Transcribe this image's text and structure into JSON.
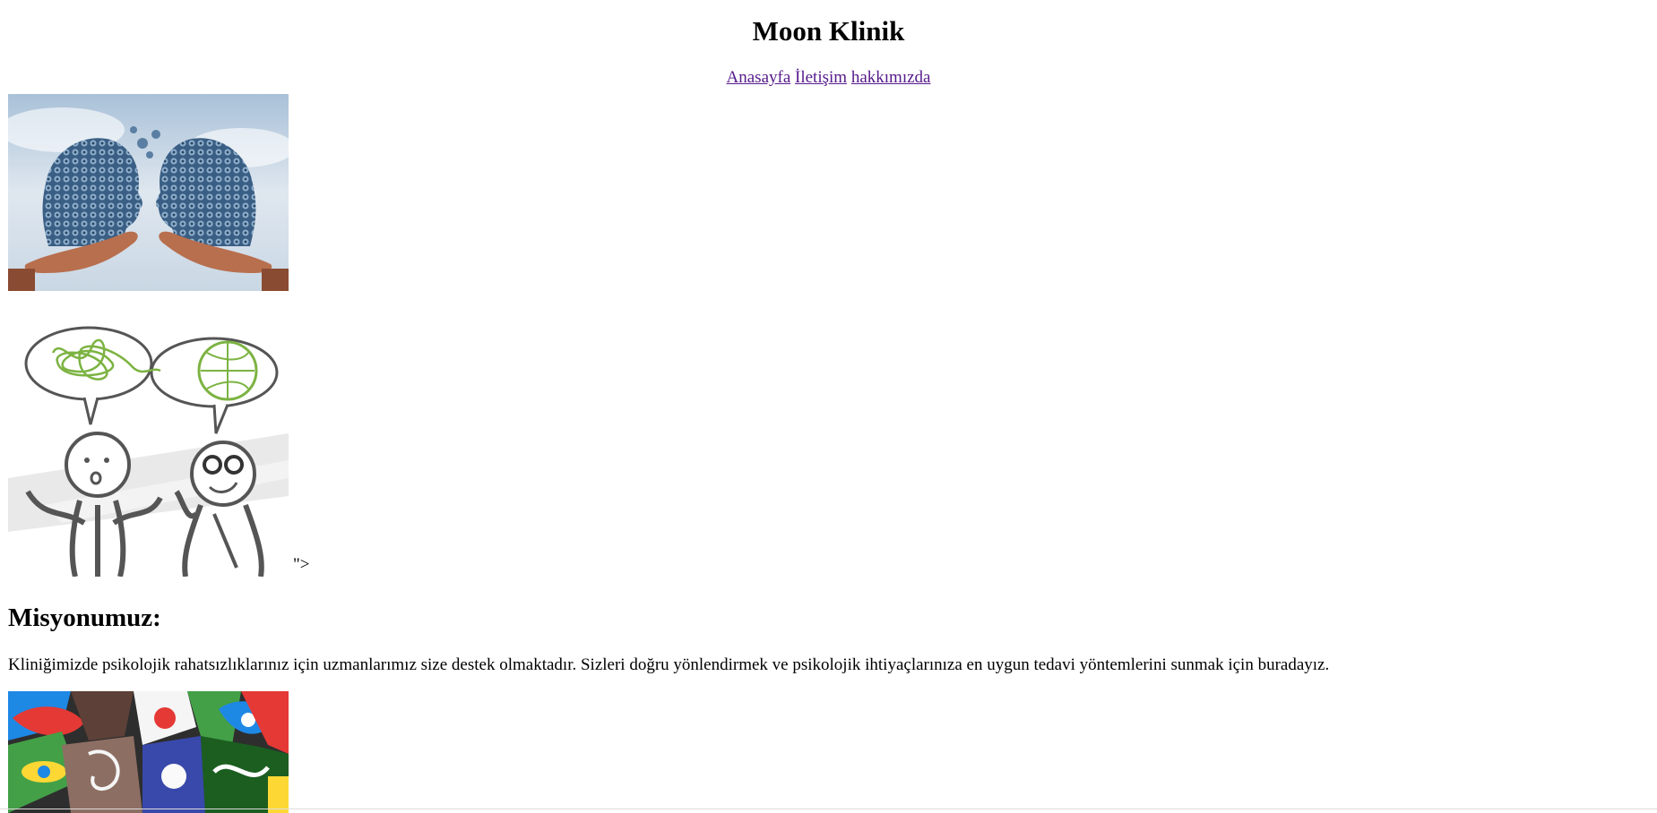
{
  "page": {
    "title": "Moon Klinik",
    "nav": [
      {
        "label": "Anasayfa"
      },
      {
        "label": "İletişim"
      },
      {
        "label": "hakkımızda"
      }
    ],
    "stray_text": "\">",
    "mission_heading": "Misyonumuz:",
    "mission_text": "Kliniğimizde psikolojik rahatsızlıklarınız için uzmanlarımız size destek olmaktadır. Sizleri doğru yönlendirmek ve psikolojik ihtiyaçlarınıza en uygun tedavi yöntemlerini sunmak için buradayız."
  },
  "images": [
    {
      "icon": "gear-heads-image",
      "description_colors": [
        "#b9cde0",
        "#3f6b95",
        "#c27a55"
      ]
    },
    {
      "icon": "stick-figures-image",
      "description_colors": [
        "#4d4d4d",
        "#7cb342",
        "#f5f5f5"
      ]
    },
    {
      "icon": "colorful-collage-image",
      "description_colors": [
        "#e53935",
        "#1e88e5",
        "#43a047",
        "#fdd835"
      ]
    }
  ]
}
